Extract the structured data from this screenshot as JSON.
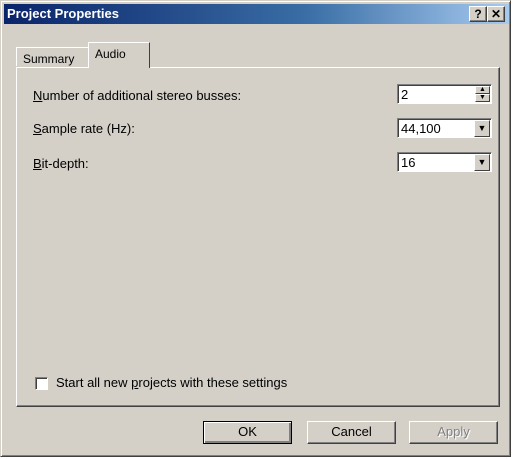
{
  "window": {
    "title": "Project Properties",
    "help_label": "?",
    "close_label": "✕"
  },
  "tabs": [
    {
      "label": "Summary",
      "active": false
    },
    {
      "label": "Audio",
      "active": true
    }
  ],
  "fields": {
    "busses": {
      "label_accel": "N",
      "label_rest": "umber of additional stereo busses:",
      "value": "2"
    },
    "sample_rate": {
      "label_accel": "S",
      "label_rest": "ample rate (Hz):",
      "value": "44,100"
    },
    "bit_depth": {
      "label_accel": "B",
      "label_rest": "it-depth:",
      "value": "16"
    }
  },
  "checkbox": {
    "label_pre": "Start all new ",
    "label_accel": "p",
    "label_post": "rojects with these settings",
    "checked": false
  },
  "buttons": {
    "ok": "OK",
    "cancel": "Cancel",
    "apply": "Apply"
  },
  "icons": {
    "spin_up": "▲",
    "spin_down": "▼",
    "dropdown": "▼"
  }
}
